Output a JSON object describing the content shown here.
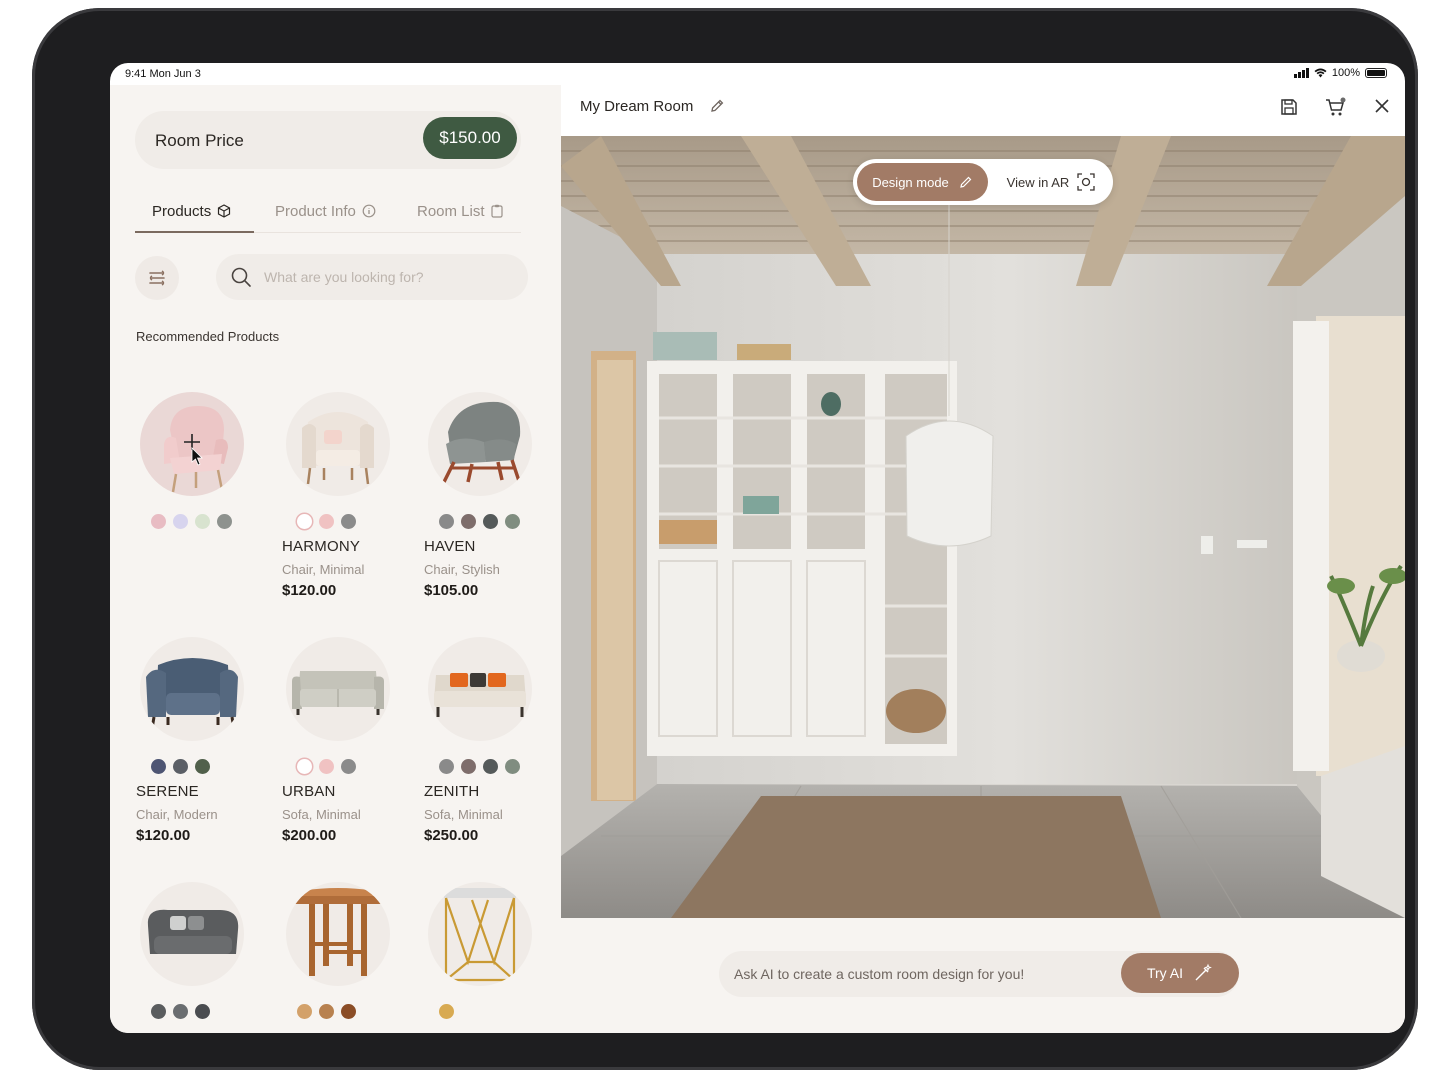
{
  "status_bar": {
    "time": "9:41  Mon Jun 3",
    "battery": "100%"
  },
  "sidebar": {
    "room_price_label": "Room Price",
    "room_price_value": "$150.00",
    "tabs": [
      {
        "label": "Products",
        "icon": "cube-icon",
        "active": true
      },
      {
        "label": "Product Info",
        "icon": "info-icon",
        "active": false
      },
      {
        "label": "Room List",
        "icon": "clipboard-icon",
        "active": false
      }
    ],
    "search_placeholder": "What are you looking for?",
    "section_title": "Recommended Products",
    "products": [
      {
        "name": "",
        "desc": "",
        "price": "",
        "swatches": [
          "#e8bcc3",
          "#d7d4ee",
          "#d8e3cf",
          "#8e928e"
        ]
      },
      {
        "name": "HARMONY",
        "desc": "Chair, Minimal",
        "price": "$120.00",
        "swatches": [
          "#ffffff",
          "#f0c2c2",
          "#8b8b8b"
        ]
      },
      {
        "name": "HAVEN",
        "desc": "Chair, Stylish",
        "price": "$105.00",
        "swatches": [
          "#8a8a8a",
          "#7e6d6b",
          "#555a5a",
          "#808d80"
        ]
      },
      {
        "name": "SERENE",
        "desc": "Chair, Modern",
        "price": "$120.00",
        "swatches": [
          "#4e5573",
          "#5b5f66",
          "#51604b"
        ]
      },
      {
        "name": "URBAN",
        "desc": "Sofa, Minimal",
        "price": "$200.00",
        "swatches": [
          "#ffffff",
          "#f0c2c2",
          "#8b8b8b"
        ]
      },
      {
        "name": "ZENITH",
        "desc": "Sofa, Minimal",
        "price": "$250.00",
        "swatches": [
          "#8a8a8a",
          "#7e6d6b",
          "#555a5a",
          "#808d80"
        ]
      },
      {
        "name": "",
        "desc": "",
        "price": "",
        "swatches": [
          "#5a5c5e",
          "#6a6d70",
          "#4a4c50"
        ]
      },
      {
        "name": "",
        "desc": "",
        "price": "",
        "swatches": [
          "#d3a16a",
          "#b8814f",
          "#8b4d26"
        ]
      },
      {
        "name": "",
        "desc": "",
        "price": "",
        "swatches": [
          "#d8aa52"
        ]
      }
    ]
  },
  "main": {
    "title": "My Dream Room",
    "design_mode_label": "Design mode",
    "view_ar_label": "View in AR",
    "ai_placeholder": "Ask AI to create a custom room design for you!",
    "ai_button_label": "Try AI"
  },
  "colors": {
    "accent": "#a27b66",
    "price_badge": "#3f5a42"
  }
}
